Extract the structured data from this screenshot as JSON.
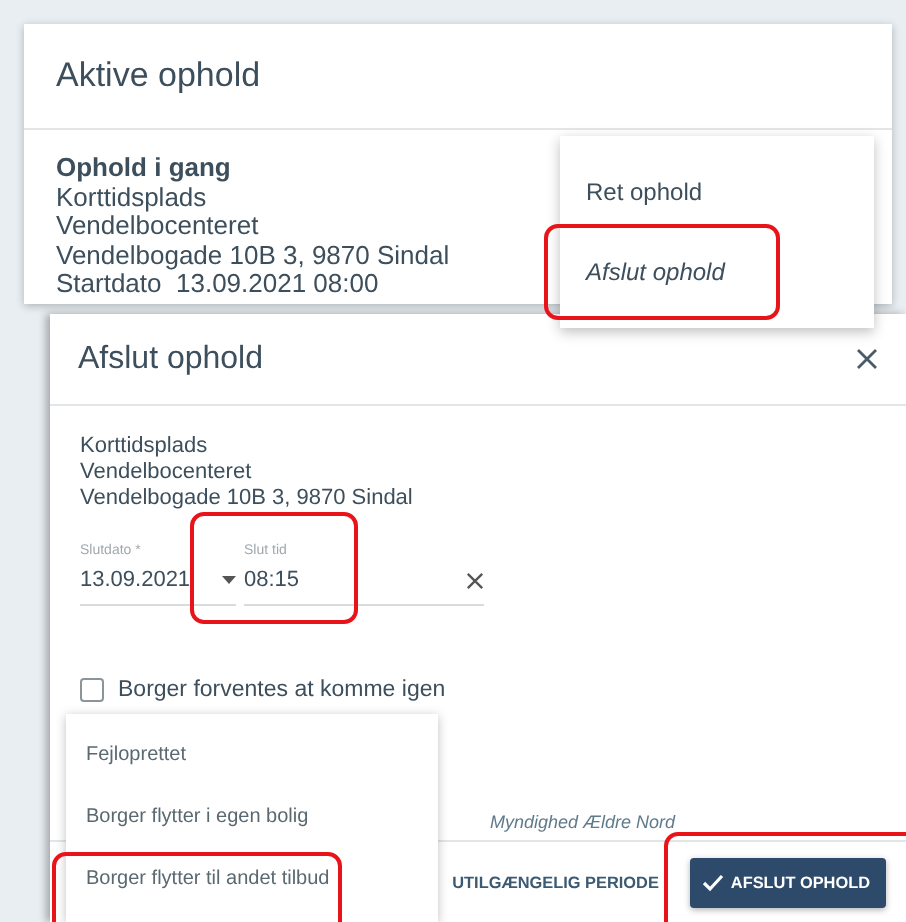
{
  "active_card": {
    "title": "Aktive ophold",
    "status": "Ophold i gang",
    "lines": [
      "Korttidsplads",
      "Vendelbocenteret",
      "Vendelbogade 10B 3, 9870 Sindal"
    ],
    "start_label": "Startdato",
    "start_value": "13.09.2021 08:00"
  },
  "context_menu": [
    {
      "label": "Ret ophold",
      "highlighted": false
    },
    {
      "label": "Afslut ophold",
      "highlighted": true
    }
  ],
  "dialog": {
    "title": "Afslut ophold",
    "lines": [
      "Korttidsplads",
      "Vendelbocenteret",
      "Vendelbogade 10B 3, 9870 Sindal"
    ],
    "fields": [
      {
        "kind": "date",
        "label": "Slutdato *",
        "value": "13.09.2021",
        "highlighted": false
      },
      {
        "kind": "time",
        "label": "Slut tid",
        "value": "08:15",
        "highlighted": true
      }
    ],
    "checkbox": {
      "label": "Borger forventes at komme igen",
      "checked": false
    },
    "note": "Myndighed Ældre Nord",
    "reason_options": [
      {
        "label": "Fejloprettet",
        "highlighted": false
      },
      {
        "label": "Borger flytter i egen bolig",
        "highlighted": false
      },
      {
        "label": "Borger flytter til andet tilbud",
        "highlighted": true
      }
    ],
    "buttons": [
      {
        "kind": "text",
        "label": "UTILGÆNGELIG PERIODE",
        "highlighted": false
      },
      {
        "kind": "primary",
        "label": "AFSLUT OPHOLD",
        "highlighted": true
      }
    ]
  }
}
